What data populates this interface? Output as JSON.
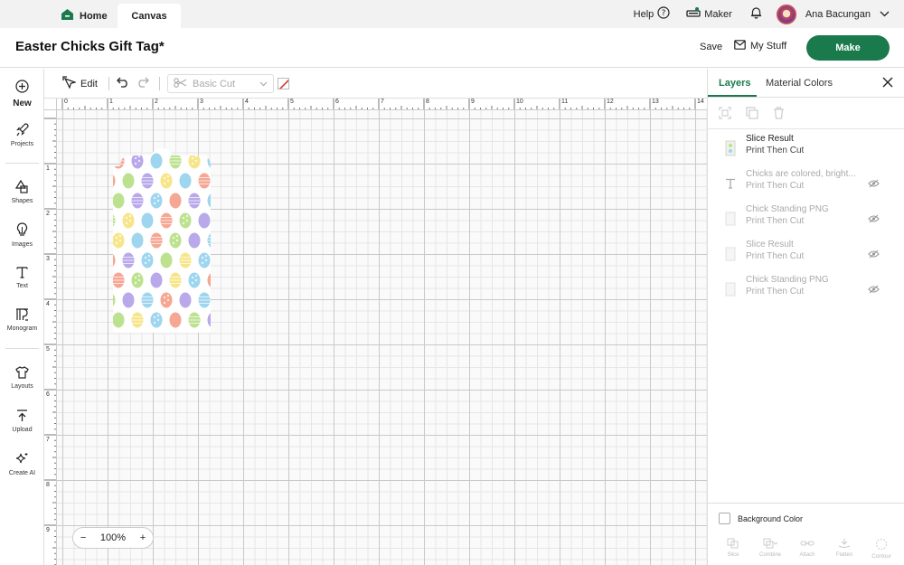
{
  "top_bar": {
    "home_label": "Home",
    "canvas_label": "Canvas",
    "help_label": "Help",
    "machine_label": "Maker",
    "user_name": "Ana Bacungan"
  },
  "title_bar": {
    "project_title": "Easter Chicks Gift Tag*",
    "save_label": "Save",
    "my_stuff_label": "My Stuff",
    "make_label": "Make"
  },
  "sidebar": {
    "items": [
      {
        "label": "New",
        "icon": "plus-circle-icon"
      },
      {
        "label": "Projects",
        "icon": "rocket-icon"
      },
      {
        "label": "Shapes",
        "icon": "shapes-icon"
      },
      {
        "label": "Images",
        "icon": "lightbulb-icon"
      },
      {
        "label": "Text",
        "icon": "text-icon"
      },
      {
        "label": "Monogram",
        "icon": "monogram-icon"
      },
      {
        "label": "Layouts",
        "icon": "shirt-icon"
      },
      {
        "label": "Upload",
        "icon": "upload-icon"
      },
      {
        "label": "Create AI",
        "icon": "sparkle-icon"
      }
    ]
  },
  "toolbar": {
    "edit_label": "Edit",
    "operation_value": "Basic Cut"
  },
  "rulers": {
    "horizontal": [
      "0",
      "1",
      "2",
      "3",
      "4",
      "5",
      "6",
      "7",
      "8",
      "9",
      "10",
      "11",
      "12",
      "13",
      "14"
    ],
    "vertical": [
      "1",
      "2",
      "3",
      "4",
      "5",
      "6",
      "7",
      "8",
      "9"
    ]
  },
  "canvas": {
    "zoom_label": "100%",
    "accent_colors": [
      "#f6a793",
      "#9ed6ef",
      "#bde28f",
      "#f7e58a",
      "#b9a9ea"
    ]
  },
  "right_panel": {
    "tabs": [
      {
        "label": "Layers",
        "active": true
      },
      {
        "label": "Material Colors",
        "active": false
      }
    ],
    "layers": [
      {
        "name": "Slice Result",
        "sub": "Print Then Cut",
        "hidden": false,
        "icon": "image-layer-icon"
      },
      {
        "name": "Chicks are colored, bright...",
        "sub": "Print Then Cut",
        "hidden": true,
        "icon": "text-layer-icon"
      },
      {
        "name": "Chick Standing PNG",
        "sub": "Print Then Cut",
        "hidden": true,
        "icon": "image-layer-icon"
      },
      {
        "name": "Slice Result",
        "sub": "Print Then Cut",
        "hidden": true,
        "icon": "image-layer-icon"
      },
      {
        "name": "Chick Standing PNG",
        "sub": "Print Then Cut",
        "hidden": true,
        "icon": "image-layer-icon"
      }
    ],
    "background_color_label": "Background Color",
    "bottom_tools": [
      {
        "label": "Slice"
      },
      {
        "label": "Combine"
      },
      {
        "label": "Attach"
      },
      {
        "label": "Flatten"
      },
      {
        "label": "Contour"
      }
    ]
  },
  "colors": {
    "brand_green": "#1a7a4c"
  }
}
